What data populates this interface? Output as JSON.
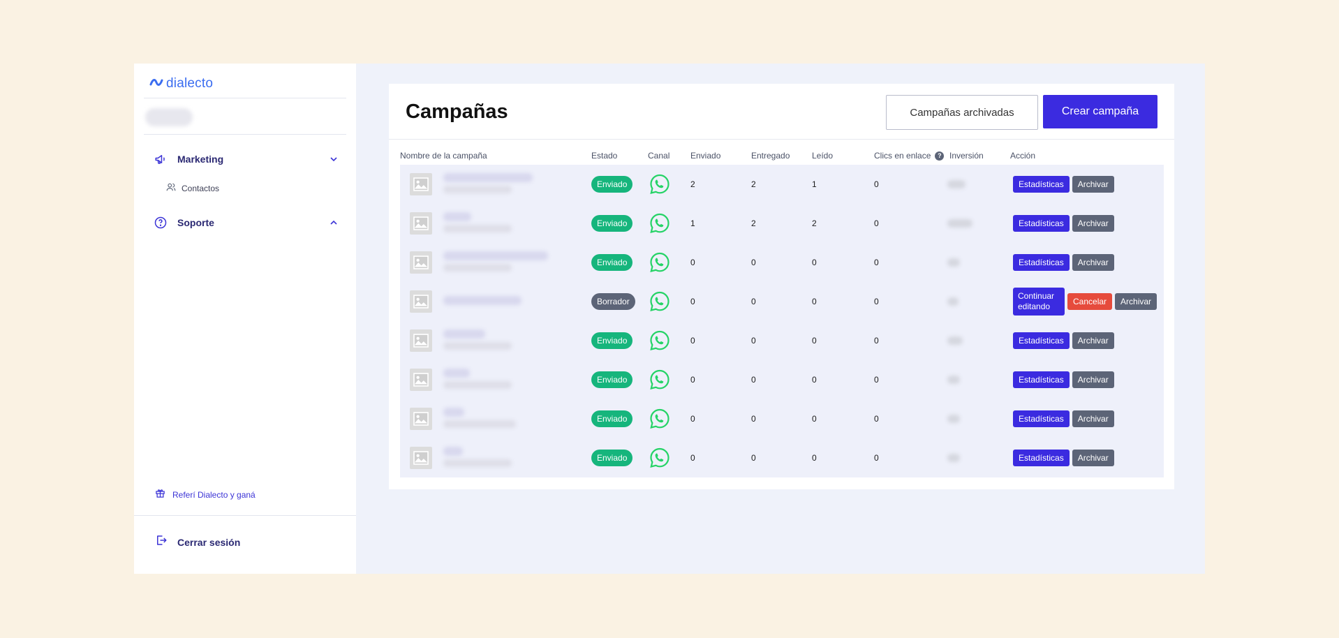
{
  "sidebar": {
    "logo": "dialecto",
    "nav": {
      "marketing": "Marketing",
      "contactos": "Contactos",
      "soporte": "Soporte"
    },
    "refer": "Referí Dialecto y ganá",
    "logout": "Cerrar sesión"
  },
  "main": {
    "title": "Campañas",
    "archived_button": "Campañas archivadas",
    "create_button": "Crear campaña",
    "columns": {
      "name": "Nombre de la campaña",
      "status": "Estado",
      "channel": "Canal",
      "sent": "Enviado",
      "delivered": "Entregado",
      "read": "Leído",
      "clicks": "Clics en enlace",
      "investment": "Inversión",
      "action": "Acción"
    },
    "actions": {
      "stats": "Estadísticas",
      "archive": "Archivar",
      "continue": "Continuar editando",
      "cancel": "Cancelar"
    },
    "rows": [
      {
        "status": "Enviado",
        "sent": "2",
        "delivered": "2",
        "read": "1",
        "clicks": "0",
        "draft": false
      },
      {
        "status": "Enviado",
        "sent": "1",
        "delivered": "2",
        "read": "2",
        "clicks": "0",
        "draft": false
      },
      {
        "status": "Enviado",
        "sent": "0",
        "delivered": "0",
        "read": "0",
        "clicks": "0",
        "draft": false
      },
      {
        "status": "Borrador",
        "sent": "0",
        "delivered": "0",
        "read": "0",
        "clicks": "0",
        "draft": true
      },
      {
        "status": "Enviado",
        "sent": "0",
        "delivered": "0",
        "read": "0",
        "clicks": "0",
        "draft": false
      },
      {
        "status": "Enviado",
        "sent": "0",
        "delivered": "0",
        "read": "0",
        "clicks": "0",
        "draft": false
      },
      {
        "status": "Enviado",
        "sent": "0",
        "delivered": "0",
        "read": "0",
        "clicks": "0",
        "draft": false
      },
      {
        "status": "Enviado",
        "sent": "0",
        "delivered": "0",
        "read": "0",
        "clicks": "0",
        "draft": false
      }
    ]
  },
  "colors": {
    "background": "#faf2e3",
    "primary": "#3b2be0",
    "success": "#16b57c",
    "neutral": "#5c6477",
    "danger": "#e64b3c",
    "whatsapp": "#25d366"
  },
  "icons": {
    "marketing": "megaphone-icon",
    "contactos": "users-icon",
    "soporte": "help-circle-icon",
    "refer": "gift-icon",
    "logout": "logout-icon",
    "channel": "whatsapp-icon",
    "thumbnail": "image-placeholder-icon"
  }
}
